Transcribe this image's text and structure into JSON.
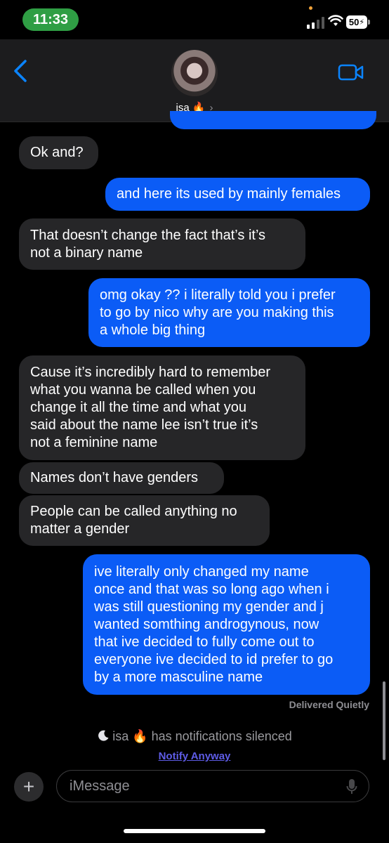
{
  "status_bar": {
    "time": "11:33",
    "battery_level": "50",
    "charging_icon": "bolt-icon",
    "signal_icon": "cellular-signal-icon",
    "wifi_icon": "wifi-icon"
  },
  "header": {
    "back_icon": "chevron-left-icon",
    "contact_name": "isa 🔥",
    "contact_chevron": "›",
    "video_icon": "video-camera-icon"
  },
  "messages": [
    {
      "direction": "incoming",
      "lines": [
        "Ok and?"
      ]
    },
    {
      "direction": "outgoing",
      "lines": [
        "and here its used by mainly females"
      ]
    },
    {
      "direction": "incoming",
      "lines": [
        "That doesn’t change the fact that’s it’s",
        "not a binary name"
      ]
    },
    {
      "direction": "outgoing",
      "lines": [
        "omg okay ?? i literally told you i prefer",
        "to go by nico why are you making this",
        "a whole big thing"
      ]
    },
    {
      "direction": "incoming",
      "lines": [
        "Cause it’s incredibly hard to remember",
        "what you wanna be called when you",
        "change it all the time and what you",
        "said about the name lee isn’t true it’s",
        "not a feminine name"
      ]
    },
    {
      "direction": "incoming",
      "lines": [
        "Names don’t have genders"
      ]
    },
    {
      "direction": "incoming",
      "lines": [
        "People can be called anything no",
        "matter a gender"
      ]
    },
    {
      "direction": "outgoing",
      "lines": [
        "ive literally only changed my name",
        "once and that was so long ago when i",
        "was still questioning my gender and j",
        "wanted somthing androgynous, now",
        "that ive decided to fully come out to",
        "everyone ive decided to id prefer to go",
        "by a more masculine name"
      ]
    }
  ],
  "delivery_status": "Delivered Quietly",
  "focus_notice": {
    "moon_icon": "moon-icon",
    "text": "isa 🔥 has notifications silenced",
    "action": "Notify Anyway"
  },
  "composer": {
    "plus_label": "+",
    "placeholder": "iMessage",
    "mic_icon": "microphone-icon"
  },
  "colors": {
    "outgoing_bubble": "#0b5cf6",
    "incoming_bubble": "#262628",
    "time_pill": "#2f9e44",
    "link": "#5e5ce6"
  }
}
